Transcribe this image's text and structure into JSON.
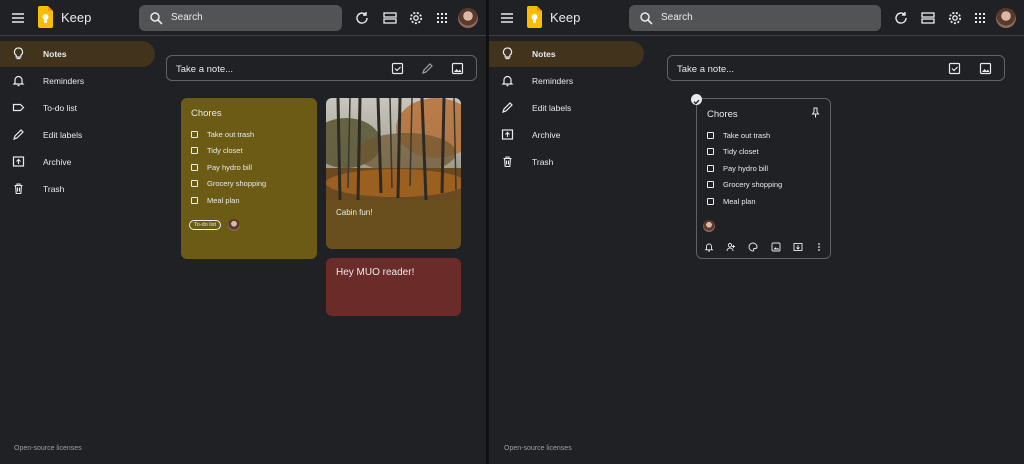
{
  "app": {
    "title": "Keep"
  },
  "search": {
    "label": "Search"
  },
  "nav_left": [
    {
      "label": "Notes"
    },
    {
      "label": "Reminders"
    },
    {
      "label": "To-do list"
    },
    {
      "label": "Edit labels"
    },
    {
      "label": "Archive"
    },
    {
      "label": "Trash"
    }
  ],
  "nav_right": [
    {
      "label": "Notes"
    },
    {
      "label": "Reminders"
    },
    {
      "label": "Edit labels"
    },
    {
      "label": "Archive"
    },
    {
      "label": "Trash"
    }
  ],
  "take_note": {
    "placeholder": "Take a note..."
  },
  "chores_note": {
    "title": "Chores",
    "items": [
      "Take out trash",
      "Tidy closet",
      "Pay hydro bill",
      "Grocery shopping",
      "Meal plan"
    ],
    "label": "To-do list"
  },
  "cabin_note": {
    "text": "Cabin fun!"
  },
  "muo_note": {
    "text": "Hey MUO reader!"
  },
  "footer": {
    "text": "Open-source licenses"
  },
  "colors": {
    "background": "#202124",
    "active_nav": "#41331c",
    "chores_card": "#6b5b15",
    "cabin_card": "#6a4f1e",
    "muo_card": "#6b2b28",
    "logo": "#fbbc04"
  }
}
